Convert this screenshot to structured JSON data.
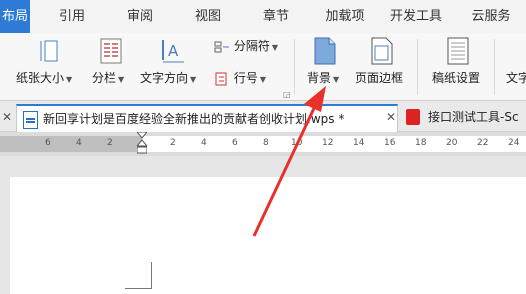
{
  "tabs": [
    {
      "label": "布局",
      "active": true
    },
    {
      "label": "引用"
    },
    {
      "label": "审阅"
    },
    {
      "label": "视图"
    },
    {
      "label": "章节"
    },
    {
      "label": "加载项"
    },
    {
      "label": "开发工具"
    },
    {
      "label": "云服务"
    }
  ],
  "ribbon": {
    "paper_size": "纸张大小",
    "columns": "分栏",
    "text_direction": "文字方向",
    "separator": "分隔符",
    "line_number": "行号",
    "background": "背景",
    "page_border": "页面边框",
    "manuscript": "稿纸设置",
    "text_more": "文字"
  },
  "doc_tabs": {
    "active": "新回享计划是百度经验全新推出的贡献者创收计划.wps *",
    "other": "接口测试工具-Sc"
  },
  "ruler_ticks": [
    "6",
    "4",
    "2",
    "2",
    "4",
    "6",
    "8",
    "10",
    "12",
    "14",
    "16",
    "18",
    "20",
    "22",
    "24"
  ],
  "colors": {
    "accent": "#2d7bd4",
    "arrow": "#e8312a"
  }
}
